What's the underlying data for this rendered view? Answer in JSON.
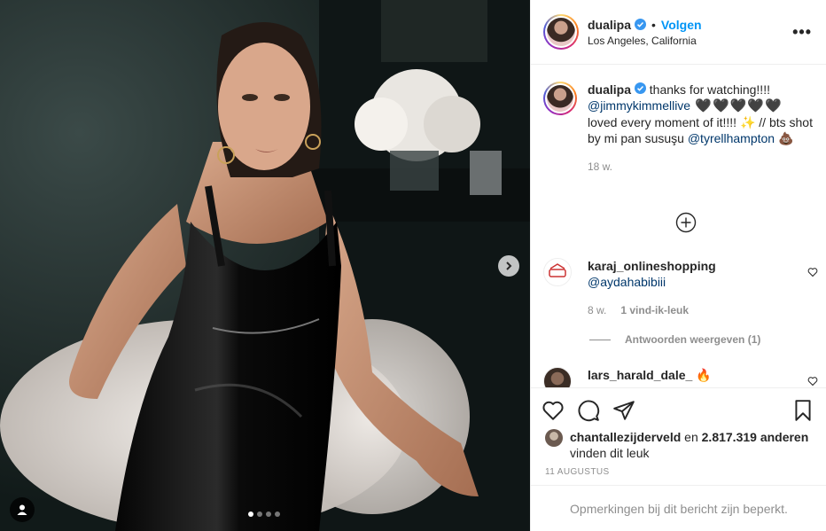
{
  "header": {
    "username": "dualipa",
    "separator": "•",
    "follow_label": "Volgen",
    "location": "Los Angeles, California",
    "more_label": "•••"
  },
  "caption": {
    "username": "dualipa",
    "text_1": " thanks for watching!!!! ",
    "mention_1": "@jimmykimmellive",
    "hearts": " 🖤🖤🖤🖤🖤 ",
    "text_2": "loved every moment of it!!!! ✨ // bts shot by mi pan susuşu ",
    "mention_2": "@tyrellhampton",
    "emoji_end": " 💩",
    "age": "18 w."
  },
  "comments": [
    {
      "username": "karaj_onlineshopping",
      "mention": "@aydahabibiii",
      "age": "8 w.",
      "likes": "1 vind-ik-leuk",
      "view_replies": "Antwoorden weergeven (1)"
    },
    {
      "username": "lars_harald_dale_",
      "text": " 🔥"
    }
  ],
  "likes": {
    "user": "chantallezijderveld",
    "middle": " en ",
    "count": "2.817.319 anderen",
    "suffix": "vinden dit leuk"
  },
  "date": "11 AUGUSTUS",
  "comments_limited": "Opmerkingen bij dit bericht zijn beperkt.",
  "colors": {
    "accent": "#0095f6",
    "mention": "#00376b",
    "muted": "#8e8e8e",
    "verified": "#3897f0"
  },
  "icons": [
    "verified-badge-icon",
    "more-options-icon",
    "load-more-icon",
    "heart-icon",
    "comment-icon",
    "share-icon",
    "save-icon",
    "next-arrow-icon",
    "user-tags-icon"
  ],
  "carousel": {
    "slides": 4,
    "active": 1
  }
}
